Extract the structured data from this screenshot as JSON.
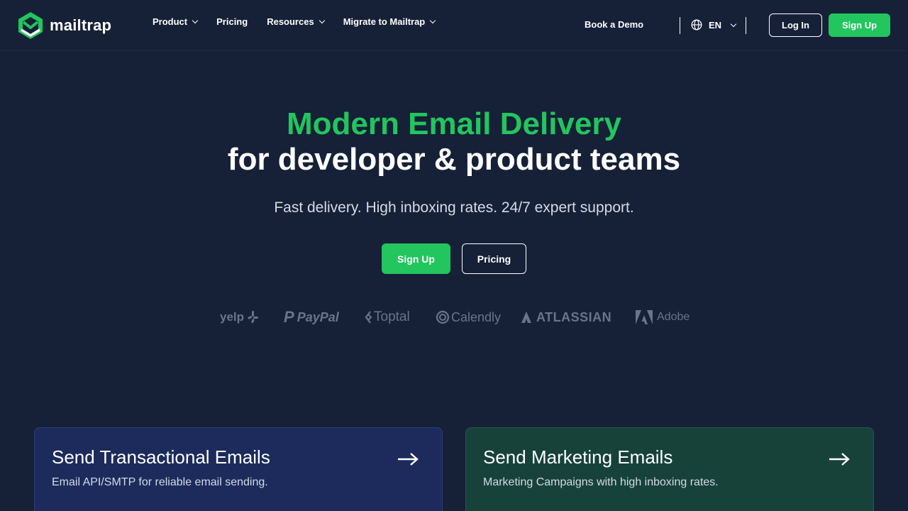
{
  "header": {
    "logo_text": "mailtrap",
    "nav": [
      {
        "label": "Product",
        "has_dropdown": true
      },
      {
        "label": "Pricing",
        "has_dropdown": false
      },
      {
        "label": "Resources",
        "has_dropdown": true
      },
      {
        "label": "Migrate to Mailtrap",
        "has_dropdown": true
      }
    ],
    "book_demo": "Book a Demo",
    "language": "EN",
    "login": "Log In",
    "signup": "Sign Up"
  },
  "hero": {
    "title_line1": "Modern Email Delivery",
    "title_line2": "for developer & product teams",
    "subtitle": "Fast delivery. High inboxing rates. 24/7 expert support.",
    "cta_primary": "Sign Up",
    "cta_secondary": "Pricing"
  },
  "clients": [
    {
      "name": "yelp",
      "mark": ""
    },
    {
      "name": "PayPal",
      "mark": "P"
    },
    {
      "name": "Toptal",
      "mark": ""
    },
    {
      "name": "Calendly",
      "mark": ""
    },
    {
      "name": "ATLASSIAN",
      "mark": ""
    },
    {
      "name": "Adobe",
      "mark": ""
    }
  ],
  "cards": [
    {
      "title": "Send Transactional Emails",
      "description": "Email API/SMTP for reliable email sending."
    },
    {
      "title": "Send Marketing Emails",
      "description": "Marketing Campaigns with high inboxing rates."
    }
  ],
  "colors": {
    "background": "#162037",
    "accent": "#22c55e",
    "card_transactional": "#1c2b5c",
    "card_marketing": "#16423a"
  }
}
